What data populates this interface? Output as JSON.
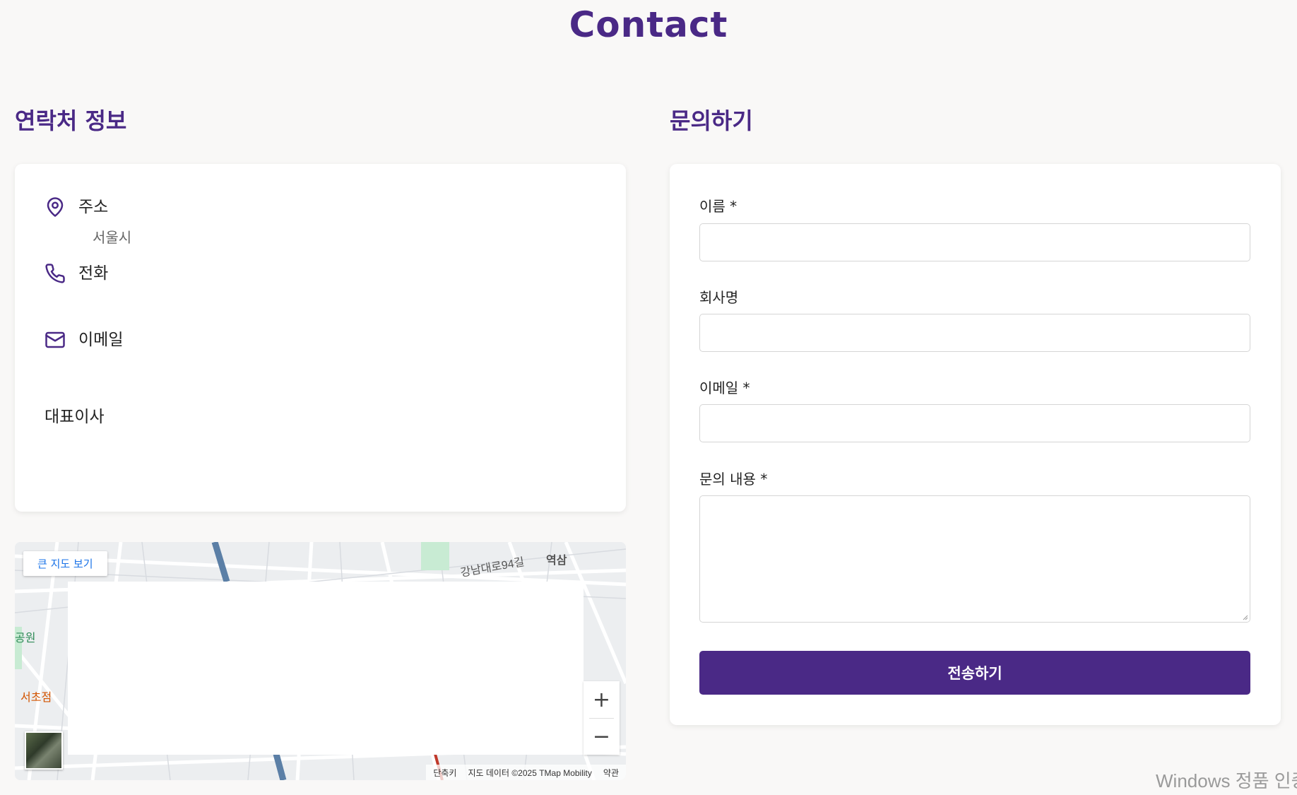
{
  "page": {
    "title": "Contact"
  },
  "contact_info": {
    "heading": "연락처 정보",
    "address": {
      "icon": "map-pin-icon",
      "label": "주소",
      "value": "서울시"
    },
    "phone": {
      "icon": "phone-icon",
      "label": "전화"
    },
    "email": {
      "icon": "mail-icon",
      "label": "이메일"
    },
    "ceo_label": "대표이사"
  },
  "map": {
    "view_larger_label": "큰 지도 보기",
    "zoom_in": "+",
    "zoom_out": "−",
    "attribution": {
      "shortcuts": "단축키",
      "data": "지도 데이터 ©2025 TMap Mobility",
      "terms": "약관"
    },
    "labels": {
      "street_94": "강남대로94길",
      "station": "역삼",
      "park": "공원",
      "branch": "서초점"
    }
  },
  "inquiry": {
    "heading": "문의하기",
    "fields": {
      "name": {
        "label": "이름 *"
      },
      "company": {
        "label": "회사명"
      },
      "email": {
        "label": "이메일 *"
      },
      "message": {
        "label": "문의 내용 *"
      }
    },
    "submit_label": "전송하기"
  },
  "os_watermark": "Windows 정품 인증",
  "colors": {
    "accent": "#4a2986",
    "background": "#f9f8f7",
    "card": "#ffffff",
    "link_blue": "#1a73e8"
  }
}
